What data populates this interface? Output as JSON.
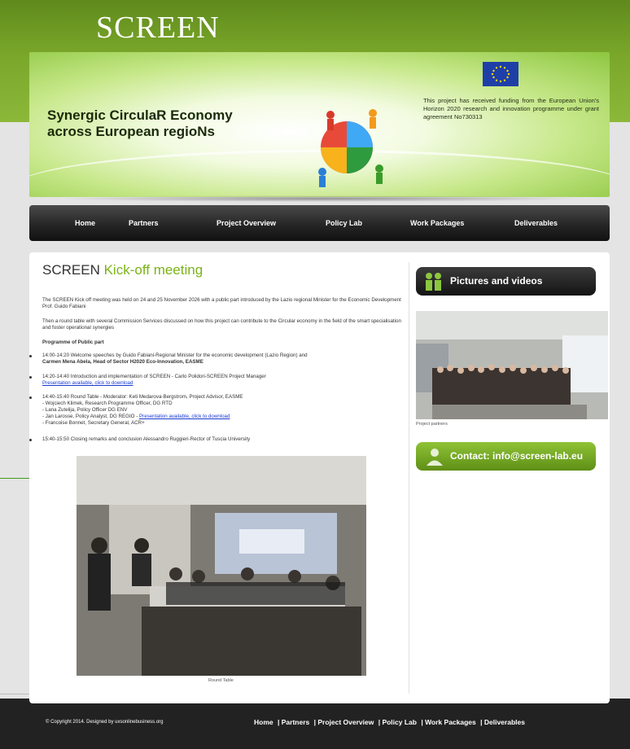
{
  "header": {
    "logo": "SCREEN",
    "banner_title_line1": "Synergic CirculaR Economy",
    "banner_title_line2": "across European regioNs",
    "eu_funding_text": "This project has received funding from the European Union's Horizon 2020 research and innovation programme under grant agreement No730313"
  },
  "nav": {
    "items": [
      "Home",
      "Partners",
      "Project Overview",
      "Policy Lab",
      "Work Packages",
      "Deliverables"
    ]
  },
  "article": {
    "title_part1": "SCREEN",
    "title_part2": "Kick-off meeting",
    "intro": "The SCREEN Kick off meeting was held on 24 and 25 November 2026 with a public part introduced by the Lazio regional Minister for the Economic Development Prof. Guido Fabiani",
    "round_table_intro": "Then a round table with several Commission Services discussed on how this project can contribute to the Circular economy in the field of the smart specialisation and foster operational synergies",
    "programme_heading": "Programme of Public part",
    "agenda": [
      {
        "line1": "14:00-14:20 Welcome speeches by Guido Fabiani-Regional Minister for the economic development (Lazio Region) and",
        "line2": "Carmen Mena Abela, Head of Sector H2020 Eco-Innovation, EASME"
      },
      {
        "line1": "14:20-14:40 Introduction and implementation of SCREEN - Carlo Polidori-SCREEN Project Manager",
        "link": "Presentation available, click to download"
      },
      {
        "line1": "14:40-15:40 Round Table - Moderator: Keti Medarova-Bergstrom, Project Advisor, EASME",
        "line2": "- Wojciech Klimek, Research Programme Officer, DG RTD",
        "line3": "- Lana Zutelija, Policy Officer DG ENV",
        "line4": "- Jan Larosse, Policy Analyst, DG REGIO -",
        "link": "Presentation available, click to download",
        "line5": "- Francoise Bonnet, Secretary General, ACR+"
      },
      {
        "line1": "15:40-15:50 Closing remarks and conclusion Alessandro Ruggieri-Rector of Tuscia University"
      }
    ],
    "photo_caption": "Round Table"
  },
  "sidebar": {
    "pictures_button": "Pictures and videos",
    "photo_caption": "Project partners",
    "contact_button": "Contact: info@screen-lab.eu"
  },
  "footer": {
    "copyright": "© Copyright 2014. Designed by uxsonlinebusiness.org",
    "links": [
      "Home",
      "Partners",
      "Project Overview",
      "Policy Lab",
      "Work Packages",
      "Deliverables"
    ]
  },
  "colors": {
    "brand_green": "#7ab317",
    "nav_dark": "#262626",
    "link_blue": "#1a3ad0"
  }
}
